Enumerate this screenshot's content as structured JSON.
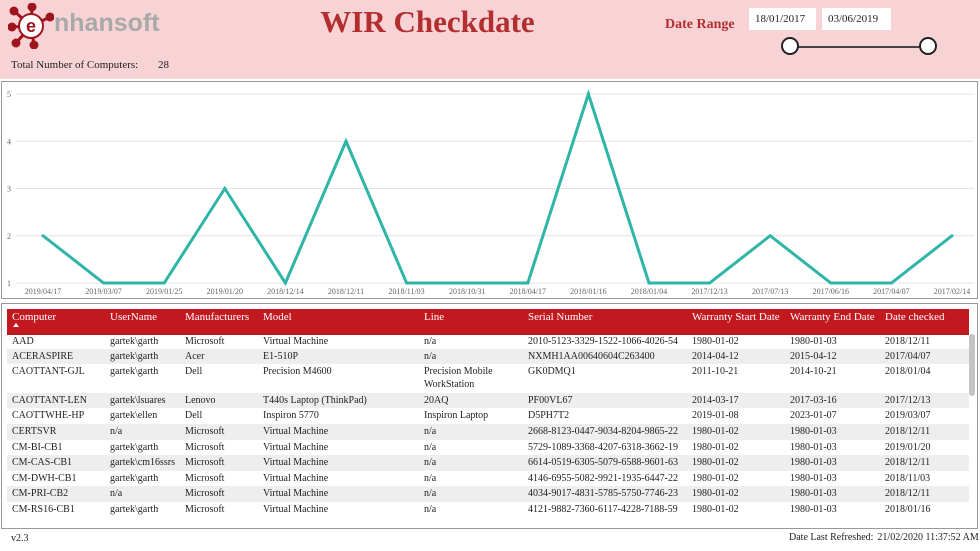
{
  "header": {
    "logo_text": "nhansoft",
    "logo_letter": "e",
    "title": "WIR Checkdate",
    "total_label": "Total Number of Computers:",
    "total_value": "28",
    "date_range_label": "Date Range",
    "date_start": "18/01/2017",
    "date_end": "03/06/2019",
    "colors": {
      "header_bg": "#f8d3d6",
      "title": "#b22e2f",
      "logo_red": "#a0141e",
      "logo_grey": "#a9a9a9"
    }
  },
  "chart_data": {
    "type": "line",
    "title": "",
    "xlabel": "",
    "ylabel": "",
    "ylim": [
      1,
      5
    ],
    "yticks": [
      1,
      2,
      3,
      4,
      5
    ],
    "grid": true,
    "color": "#2eb5a7",
    "x": [
      "2019/04/17",
      "2019/03/07",
      "2019/01/25",
      "2019/01/20",
      "2018/12/14",
      "2018/12/11",
      "2018/11/03",
      "2018/10/31",
      "2018/04/17",
      "2018/01/16",
      "2018/01/04",
      "2017/12/13",
      "2017/07/13",
      "2017/06/16",
      "2017/04/07",
      "2017/02/14"
    ],
    "values": [
      2,
      1,
      1,
      3,
      1,
      4,
      1,
      1,
      1,
      5,
      1,
      1,
      2,
      1,
      1,
      2
    ]
  },
  "table": {
    "columns": [
      {
        "label": "Computer"
      },
      {
        "label": "UserName"
      },
      {
        "label": "Manufacturers"
      },
      {
        "label": "Model"
      },
      {
        "label": "Line"
      },
      {
        "label": "Serial Number"
      },
      {
        "label": "Warranty Start Date"
      },
      {
        "label": "Warranty End Date"
      },
      {
        "label": "Date checked"
      }
    ],
    "rows": [
      [
        "AAD",
        "gartek\\garth",
        "Microsoft",
        "Virtual Machine",
        "n/a",
        "2010-5123-3329-1522-1066-4026-54",
        "1980-01-02",
        "1980-01-03",
        "2018/12/11"
      ],
      [
        "ACERASPIRE",
        "gartek\\garth",
        "Acer",
        "E1-510P",
        "n/a",
        "NXMH1AA00640604C263400",
        "2014-04-12",
        "2015-04-12",
        "2017/04/07"
      ],
      [
        "CAOTTANT-GJL",
        "gartek\\garth",
        "Dell",
        "Precision M4600",
        "Precision Mobile WorkStation",
        "GK0DMQ1",
        "2011-10-21",
        "2014-10-21",
        "2018/01/04"
      ],
      [
        "CAOTTANT-LEN",
        "gartek\\lsuares",
        "Lenovo",
        "T440s Laptop (ThinkPad)",
        "20AQ",
        "PF00VL67",
        "2014-03-17",
        "2017-03-16",
        "2017/12/13"
      ],
      [
        "CAOTTWHE-HP",
        "gartek\\ellen",
        "Dell",
        "Inspiron 5770",
        "Inspiron Laptop",
        "D5PH7T2",
        "2019-01-08",
        "2023-01-07",
        "2019/03/07"
      ],
      [
        "CERTSVR",
        "n/a",
        "Microsoft",
        "Virtual Machine",
        "n/a",
        "2668-8123-0447-9034-8204-9865-22",
        "1980-01-02",
        "1980-01-03",
        "2018/12/11"
      ],
      [
        "CM-BI-CB1",
        "gartek\\garth",
        "Microsoft",
        "Virtual Machine",
        "n/a",
        "5729-1089-3368-4207-6318-3662-19",
        "1980-01-02",
        "1980-01-03",
        "2019/01/20"
      ],
      [
        "CM-CAS-CB1",
        "gartek\\cm16ssrs",
        "Microsoft",
        "Virtual Machine",
        "n/a",
        "6614-0519-6305-5079-6588-9601-63",
        "1980-01-02",
        "1980-01-03",
        "2018/12/11"
      ],
      [
        "CM-DWH-CB1",
        "gartek\\garth",
        "Microsoft",
        "Virtual Machine",
        "n/a",
        "4146-6955-5082-9921-1935-6447-22",
        "1980-01-02",
        "1980-01-03",
        "2018/11/03"
      ],
      [
        "CM-PRI-CB2",
        "n/a",
        "Microsoft",
        "Virtual Machine",
        "n/a",
        "4034-9017-4831-5785-5750-7746-23",
        "1980-01-02",
        "1980-01-03",
        "2018/12/11"
      ],
      [
        "CM-RS16-CB1",
        "gartek\\garth",
        "Microsoft",
        "Virtual Machine",
        "n/a",
        "4121-9882-7360-6117-4228-7188-59",
        "1980-01-02",
        "1980-01-03",
        "2018/01/16"
      ]
    ]
  },
  "footer": {
    "version": "v2.3",
    "refreshed_label": "Date Last Refreshed:",
    "refreshed_value": "21/02/2020 11:37:52 AM"
  }
}
